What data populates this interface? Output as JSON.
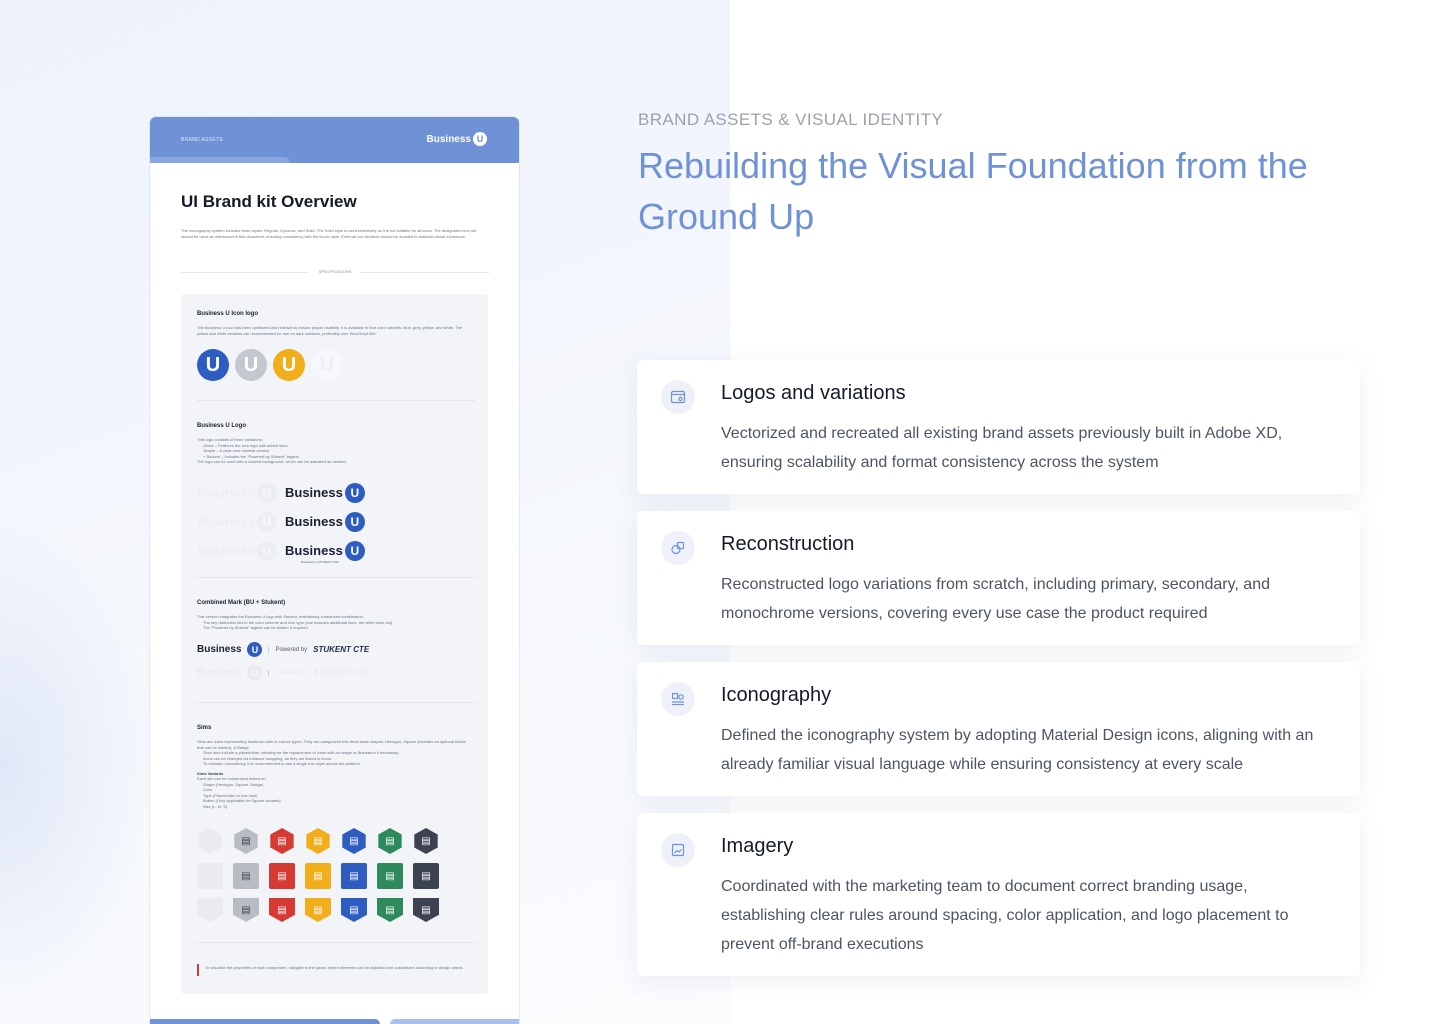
{
  "doc": {
    "header_label": "BRAND ASSETS",
    "brand_word": "Business",
    "brand_letter": "U",
    "title": "UI Brand kit Overview",
    "intro": "The iconography system includes three styles: Regular, Dynamic, and Solid. The Solid style is used selectively as it is not suitable for all icons. The designated icon set should be used as referenced in this document, ensuring consistency with the iconic style. External icon libraries should be avoided to maintain visual coherence.",
    "spec_label": "SPECIFICATIONS",
    "icon_logo": {
      "title": "Business U Icon logo",
      "text": "The Business U icon has been optimized and redrawn to ensure proper usability. It is available in four color variants: blue, grey, yellow, and white. The yellow and white versions are recommended for use on dark surfaces, preferably over BlueGrey1000.",
      "badges": [
        {
          "letter": "U",
          "color": "#2f5cc1"
        },
        {
          "letter": "U",
          "color": "#c4c7cf"
        },
        {
          "letter": "U",
          "color": "#f2ad1a"
        },
        {
          "letter": "U",
          "color": "#f7f8fb"
        }
      ]
    },
    "logo": {
      "title": "Business U Logo",
      "text": "This logo consists of three variations:",
      "bullets": [
        "Globe – Features the icon logo with added lines.",
        "Simple – A clean and minimal version.",
        "+ Stukent – Includes the \"Powered by Stukent\" tagline."
      ],
      "after": "The logo can be used with a colored background, which can be activated as needed.",
      "wordmark": "Business",
      "letter": "U",
      "tagline": "Powered by STUKENT CTE"
    },
    "combined": {
      "title": "Combined Mark (BU + Stukent)",
      "text": "This version integrates the Business U logo with Stukent, maintaining a balanced combination.",
      "bullets": [
        "The key distinction lies in the color scheme and icon type (one includes additional lines, the other does not).",
        "The \"Powered by Stukent\" tagline can be hidden if required."
      ],
      "wordmark": "Business",
      "letter": "U",
      "powered": "Powered by",
      "stukent": "STUKENT CTE"
    },
    "sims": {
      "title": "Sims",
      "text": "Sims are icons representing business units or course types. They are categorized into three base shapes: Hexagon, Square (includes an optional button that can be hidden), & Badge.",
      "bullets": [
        "Sims also include a placeholder, allowing for the replacement of icons with an image or illustration if necessary.",
        "Icons can be changed via instance swapping, as they are linked to icons.",
        "To maintain consistency, it is recommended to use a single icon style across the platform."
      ],
      "variants_title": "Sims Variants",
      "variants_text": "Each sim can be customized based on:",
      "variant_bullets": [
        "Shape (Hexagon, Square, Badge)",
        "Color",
        "Type (Placeholder or Icon tool)",
        "Button (Only applicable for Square variants)",
        "Size (L, M, S)"
      ],
      "colors": [
        "#e9ebf1",
        "#b9bcc5",
        "#d63a34",
        "#f2ad1a",
        "#2f5cc1",
        "#2e8a5a",
        "#3c4250"
      ],
      "icon_glyph": "▤"
    },
    "note": "To visualize the properties of each component, navigate to the panel, where elements can be adjusted and customized according to design needs."
  },
  "eyebrow": "BRAND ASSETS & VISUAL IDENTITY",
  "headline": "Rebuilding the Visual Foundation from the Ground Up",
  "cards": [
    {
      "icon": "browser-settings-icon",
      "title": "Logos and variations",
      "text": "Vectorized and recreated all existing brand assets previously built in Adobe XD, ensuring scalability and format consistency across the system"
    },
    {
      "icon": "shapes-icon",
      "title": "Reconstruction",
      "text": "Reconstructed logo variations from scratch, including primary, secondary, and monochrome versions, covering every use case the product required"
    },
    {
      "icon": "icon-stack-icon",
      "title": "Iconography",
      "text": "Defined the iconography system by adopting Material Design icons, aligning with an already familiar visual language while ensuring consistency at every scale"
    },
    {
      "icon": "image-icon",
      "title": "Imagery",
      "text": "Coordinated with the marketing team to document correct branding usage, establishing clear rules around spacing, color application, and logo placement to prevent off-brand executions"
    }
  ],
  "colors": {
    "accent": "#6f91d6",
    "brand_blue": "#2f5cc1"
  }
}
